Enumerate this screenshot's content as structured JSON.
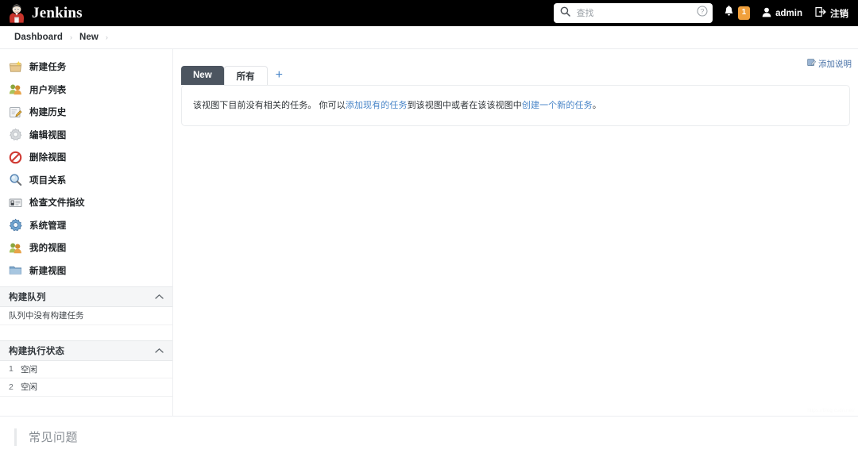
{
  "header": {
    "brand": "Jenkins",
    "brand_logo_icon": "jenkins-butler-logo",
    "search": {
      "placeholder": "查找",
      "value": "",
      "search_icon": "search-icon",
      "help_icon": "help-circle-icon"
    },
    "notifications": {
      "bell_icon": "bell-icon",
      "count": "1",
      "badge_color": "#f0a03c"
    },
    "user": {
      "person_icon": "person-icon",
      "name": "admin"
    },
    "logout": {
      "icon": "logout-icon",
      "label": "注销"
    },
    "background_color": "#000000"
  },
  "breadcrumb": {
    "separator": "›",
    "items": [
      {
        "label": "Dashboard"
      },
      {
        "label": "New"
      }
    ],
    "trailing_separator": "›"
  },
  "sidebar": {
    "items": [
      {
        "label": "新建任务",
        "icon": "new-job-icon"
      },
      {
        "label": "用户列表",
        "icon": "people-icon"
      },
      {
        "label": "构建历史",
        "icon": "history-notepad-icon"
      },
      {
        "label": "编辑视图",
        "icon": "gear-grey-icon"
      },
      {
        "label": "删除视图",
        "icon": "delete-prohibited-icon"
      },
      {
        "label": "项目关系",
        "icon": "magnifier-icon"
      },
      {
        "label": "检查文件指纹",
        "icon": "fingerprint-card-icon"
      },
      {
        "label": "系统管理",
        "icon": "gear-blue-icon"
      },
      {
        "label": "我的视图",
        "icon": "people-icon"
      },
      {
        "label": "新建视图",
        "icon": "folder-icon"
      }
    ],
    "build_queue": {
      "title": "构建队列",
      "collapse_icon": "chevron-up-icon",
      "empty_text": "队列中没有构建任务"
    },
    "build_executor_status": {
      "title": "构建执行状态",
      "collapse_icon": "chevron-up-icon",
      "executors": [
        {
          "num": "1",
          "status": "空闲"
        },
        {
          "num": "2",
          "status": "空闲"
        }
      ]
    }
  },
  "main": {
    "add_description": {
      "label": "添加说明",
      "icon": "edit-note-icon"
    },
    "tabs": [
      {
        "label": "New",
        "active": true
      },
      {
        "label": "所有",
        "active": false
      }
    ],
    "add_tab_icon": "plus-icon",
    "empty_view": {
      "text_before": "该视图下目前没有相关的任务。 你可以",
      "link1": "添加现有的任务",
      "text_middle": "到该视图中或者在该该视图中",
      "link2": "创建一个新的任务",
      "text_after": "。"
    },
    "watermark": "https://blog.csdn.net/"
  },
  "footer": {
    "faq_label": "常见问题"
  },
  "colors": {
    "accent_link": "#4a86c8",
    "active_tab": "#4c5560",
    "badge": "#f0a03c",
    "header_bg": "#000000"
  }
}
